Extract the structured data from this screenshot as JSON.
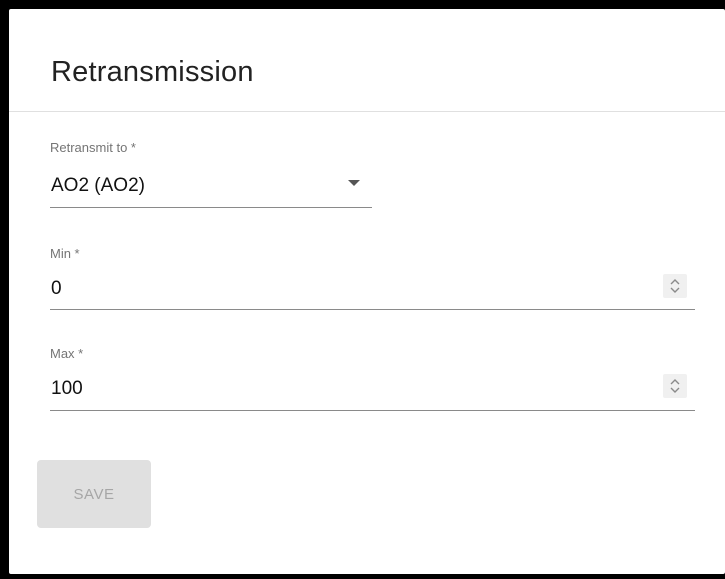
{
  "card": {
    "title": "Retransmission"
  },
  "retransmit": {
    "label": "Retransmit to *",
    "value": "AO2 (AO2)"
  },
  "min": {
    "label": "Min *",
    "value": "0"
  },
  "max": {
    "label": "Max *",
    "value": "100"
  },
  "save": {
    "label": "SAVE",
    "disabled": true
  },
  "icons": {
    "dropdown": "chevron-down-icon",
    "spinner": "spinner-arrows-icon"
  },
  "colors": {
    "background": "#ffffff",
    "frame": "#000000",
    "divider": "#e0e0e0",
    "label": "#757575",
    "text": "#111111",
    "button_bg": "#e0e0e0",
    "button_text": "#a6a6a6"
  }
}
